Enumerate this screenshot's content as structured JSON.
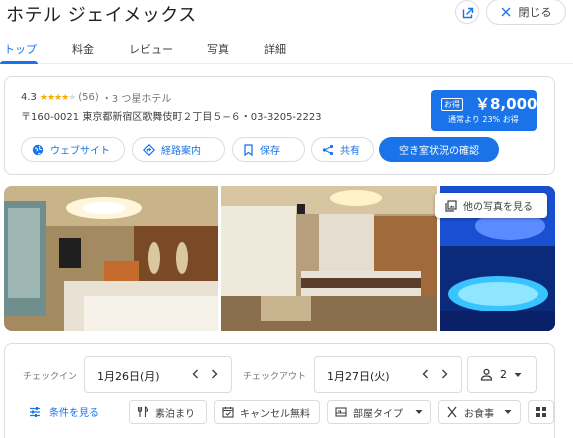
{
  "header": {
    "title": "ホテル ジェイメックス",
    "close_label": "閉じる"
  },
  "tabs": [
    {
      "label": "トップ",
      "active": true
    },
    {
      "label": "料金"
    },
    {
      "label": "レビュー"
    },
    {
      "label": "写真"
    },
    {
      "label": "詳細"
    }
  ],
  "overview": {
    "rating": "4.3",
    "stars": 4.3,
    "review_count": "(56)",
    "hotel_class": "・3 つ星ホテル",
    "address_line": "〒160-0021 東京都新宿区歌舞伎町２丁目５−６・03-3205-2223",
    "deal_badge": "お得",
    "price": "￥8,000",
    "price_note": "通常より 23% お得",
    "actions": {
      "website": "ウェブサイト",
      "directions": "経路案内",
      "save": "保存",
      "share": "共有",
      "availability": "空き室状況の確認"
    }
  },
  "photos": {
    "more_label": "他の写真を見る"
  },
  "booking": {
    "checkin_label": "チェックイン",
    "checkin_value": "1月26日(月)",
    "checkout_label": "チェックアウト",
    "checkout_value": "1月27日(火)",
    "guests": "2"
  },
  "filters": {
    "conditions_label": "条件を見る",
    "chips": [
      "素泊まり",
      "キャンセル無料",
      "部屋タイプ",
      "お食事"
    ]
  },
  "colors": {
    "accent": "#1a73e8",
    "star": "#f9ab00",
    "border": "#dadce0"
  }
}
